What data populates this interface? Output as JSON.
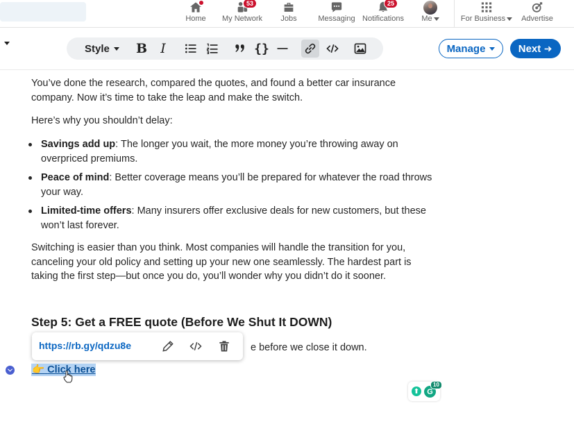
{
  "nav": {
    "items": [
      {
        "label": "Home",
        "icon": "home-icon"
      },
      {
        "label": "My Network",
        "icon": "network-icon",
        "badge": "53"
      },
      {
        "label": "Jobs",
        "icon": "briefcase-icon"
      },
      {
        "label": "Messaging",
        "icon": "messaging-icon"
      },
      {
        "label": "Notifications",
        "icon": "bell-icon",
        "badge": "25"
      },
      {
        "label": "Me",
        "icon": "avatar"
      },
      {
        "label": "For Business",
        "icon": "grid-icon"
      },
      {
        "label": "Advertise",
        "icon": "advertise-icon"
      }
    ]
  },
  "toolbar": {
    "style_label": "Style",
    "manage_label": "Manage",
    "next_label": "Next"
  },
  "article": {
    "p1": "You’ve done the research, compared the quotes, and found a better car insurance company. Now it’s time to take the leap and make the switch.",
    "p2": "Here’s why you shouldn’t delay:",
    "bullets": [
      {
        "bold": "Savings add up",
        "text": ": The longer you wait, the more money you’re throwing away on overpriced premiums."
      },
      {
        "bold": "Peace of mind",
        "text": ": Better coverage means you’ll be prepared for whatever the road throws your way."
      },
      {
        "bold": "Limited-time offers",
        "text": ": Many insurers offer exclusive deals for new customers, but these won’t last forever."
      }
    ],
    "p3": "Switching is easier than you think. Most companies will handle the transition for you, canceling your old policy and setting up your new one seamlessly. The hardest part is taking the first step—but once you do, you’ll wonder why you didn’t do it sooner.",
    "heading": "Step 5: Get a FREE quote (Before We Shut It DOWN)",
    "partial_line": "e before we close it down.",
    "link_emoji": "👉",
    "link_text": "Click here"
  },
  "popover": {
    "url": "https://rb.gy/qdzu8e"
  },
  "grammarly": {
    "count": "10"
  },
  "colors": {
    "brand": "#0a66c2",
    "badge": "#cb112d",
    "selection": "#b4d3f3",
    "grammarly": "#15c39a"
  }
}
